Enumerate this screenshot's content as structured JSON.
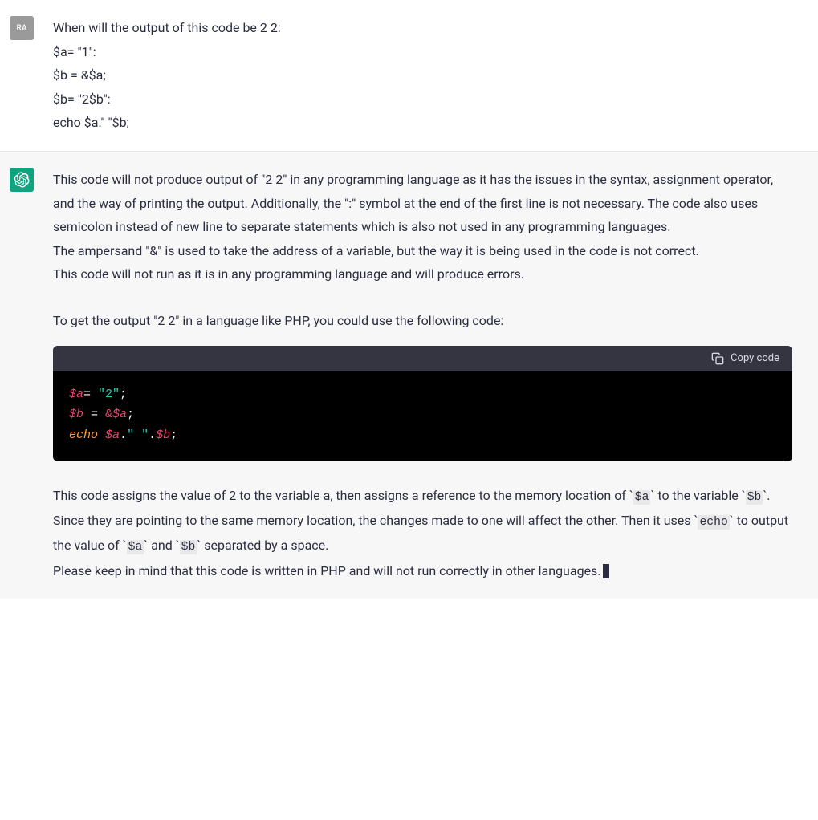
{
  "user": {
    "avatar_label": "RA",
    "lines": [
      "When will the output of this code be 2 2:",
      "$a= \"1\":",
      "$b = &$a;",
      "$b= \"2$b\":",
      "echo $a.\" \"$b;"
    ]
  },
  "assistant": {
    "p1": "This code will not produce output of \"2 2\" in any programming language as it has the issues in the syntax, assignment operator, and the way of printing the output. Additionally, the \":\" symbol at the end of the first line is not necessary. The code also uses semicolon instead of new line to separate statements which is also not used in any programming languages.",
    "p2": "The ampersand \"&\" is used to take the address of a variable, but the way it is being used in the code is not correct.",
    "p3": "This code will not run as it is in any programming language and will produce errors.",
    "p4": "To get the output \"2 2\" in a language like PHP, you could use the following code:",
    "code": {
      "copy_label": "Copy code",
      "tokens": [
        [
          {
            "t": "$a",
            "c": "tok-var"
          },
          {
            "t": "= ",
            "c": "tok-op"
          },
          {
            "t": "\"2\"",
            "c": "tok-str"
          },
          {
            "t": ";",
            "c": "tok-punc"
          }
        ],
        [
          {
            "t": "$b",
            "c": "tok-var"
          },
          {
            "t": " = ",
            "c": "tok-op"
          },
          {
            "t": "&",
            "c": "tok-amp"
          },
          {
            "t": "$a",
            "c": "tok-var"
          },
          {
            "t": ";",
            "c": "tok-punc"
          }
        ],
        [
          {
            "t": "echo",
            "c": "tok-echo"
          },
          {
            "t": " ",
            "c": "tok-op"
          },
          {
            "t": "$a",
            "c": "tok-var"
          },
          {
            "t": ".",
            "c": "tok-dot"
          },
          {
            "t": "\" \"",
            "c": "tok-str"
          },
          {
            "t": ".",
            "c": "tok-dot"
          },
          {
            "t": "$b",
            "c": "tok-var"
          },
          {
            "t": ";",
            "c": "tok-punc"
          }
        ]
      ]
    },
    "p5_parts": [
      {
        "text": "This code assigns the value of 2 to the variable a, then assigns a reference to the memory location of `"
      },
      {
        "code": "$a"
      },
      {
        "text": "` to the variable `"
      },
      {
        "code": "$b"
      },
      {
        "text": "`. Since they are pointing to the same memory location, the changes made to one will affect the other. Then it uses `"
      },
      {
        "code": "echo"
      },
      {
        "text": "` to output the value of `"
      },
      {
        "code": "$a"
      },
      {
        "text": "` and `"
      },
      {
        "code": "$b"
      },
      {
        "text": "` separated by a space."
      }
    ],
    "p6": "Please keep in mind that this code is written in PHP and will not run correctly in other languages."
  }
}
